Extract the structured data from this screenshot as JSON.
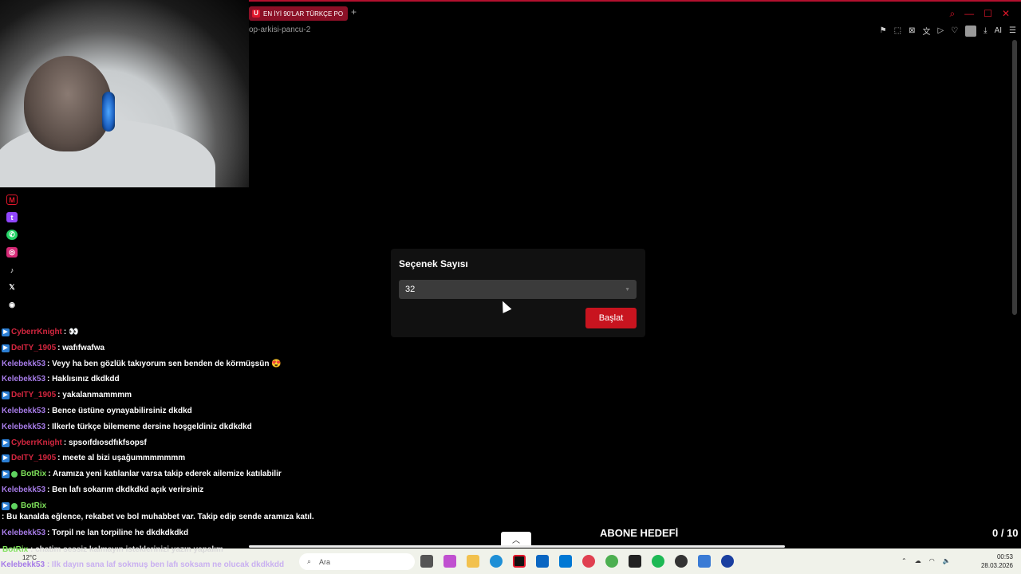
{
  "browser": {
    "tab_title": "EN İYİ 90'LAR TÜRKÇE PO",
    "tab_logo": "U",
    "new_tab": "+",
    "address": "op-arkisi-pancu-2",
    "toolbar_ai": "AI"
  },
  "modal": {
    "title": "Seçenek Sayısı",
    "selected_value": "32",
    "start_button": "Başlat"
  },
  "chat": {
    "messages": [
      {
        "user": "CyberrKnight",
        "text": ": 👀",
        "color": "red"
      },
      {
        "user": "DeITY_1905",
        "text": ": wafıfwafwa",
        "color": "red"
      },
      {
        "user": "Kelebekk53",
        "text": ": Veyy ha ben gözlük takıyorum sen benden de körmüşsün 😍",
        "color": "purple"
      },
      {
        "user": "Kelebekk53",
        "text": ": Haklısınız dkdkdd",
        "color": "purple"
      },
      {
        "user": "DeITY_1905",
        "text": ": yakalanmammmm",
        "color": "red"
      },
      {
        "user": "Kelebekk53",
        "text": ": Bence üstüne oynayabilirsiniz dkdkd",
        "color": "purple"
      },
      {
        "user": "Kelebekk53",
        "text": ": Ilkerle türkçe bilememe dersine hoşgeldiniz dkdkdkd",
        "color": "purple"
      },
      {
        "user": "CyberrKnight",
        "text": ": spsoıfdıosdfıkfsopsf",
        "color": "red"
      },
      {
        "user": "DeITY_1905",
        "text": ": meete al bizi uşağummmmmmm",
        "color": "red"
      },
      {
        "user": "BotRix",
        "text": ": Aramıza yeni katılanlar varsa takip ederek ailemize katılabilir",
        "color": "green"
      },
      {
        "user": "Kelebekk53",
        "text": ": Ben lafı sokarım dkdkdkd açık verirsiniz",
        "color": "purple"
      },
      {
        "user": "BotRix",
        "text": ": Bu kanalda eğlence, rekabet ve bol muhabbet var. Takip edip sende aramıza katıl.",
        "color": "green"
      },
      {
        "user": "Kelebekk53",
        "text": ": Torpil ne lan torpiline he dkdkdkdkd",
        "color": "purple"
      }
    ],
    "overlay_1_user": "BotRix",
    "overlay_1_text": ": chatim sessiz kalmayın isteklerinizi yazın yapalım",
    "overlay_2_user": "Kelebekk53",
    "overlay_2_text": ": Ilk dayın sana laf sokmuş ben lafı soksam ne olucak dkdkkdd"
  },
  "goal": {
    "label": "ABONE HEDEFİ",
    "count": "0 / 10"
  },
  "taskbar": {
    "temperature": "12°C",
    "search_placeholder": "Ara",
    "time": "00:53",
    "date": "28.03.2026"
  },
  "colors": {
    "accent_red": "#c8141f",
    "user_red": "#d3263f",
    "user_purple": "#a77ce8",
    "user_green": "#7ee05a"
  }
}
